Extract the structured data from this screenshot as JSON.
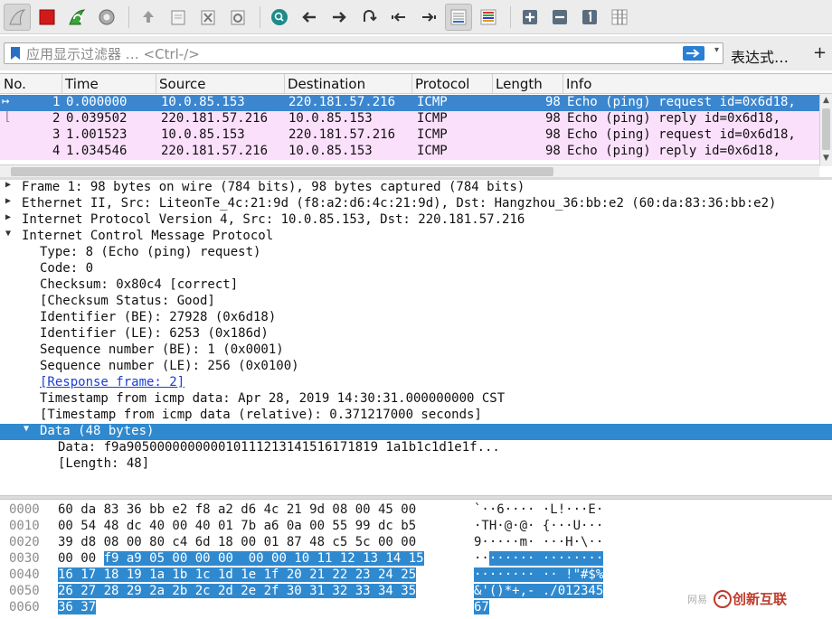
{
  "filter": {
    "placeholder": "应用显示过滤器 … <Ctrl-/>",
    "expression_label": "表达式…",
    "add_label": "+"
  },
  "toolbar": {
    "icons": [
      "shark-fin-start-icon",
      "stop-capture-icon",
      "restart-capture-icon",
      "capture-options-icon",
      "open-file-icon",
      "save-file-icon",
      "close-file-icon",
      "reload-file-icon",
      "find-packet-icon",
      "go-back-icon",
      "go-forward-icon",
      "go-to-packet-icon",
      "first-packet-icon",
      "last-packet-icon",
      "autoscroll-icon",
      "colorize-icon",
      "zoom-in-icon",
      "zoom-out-icon",
      "normal-size-icon",
      "resize-columns-icon"
    ]
  },
  "packet_list": {
    "columns": [
      "No.",
      "Time",
      "Source",
      "Destination",
      "Protocol",
      "Length",
      "Info"
    ],
    "rows": [
      {
        "no": "1",
        "time": "0.000000",
        "src": "10.0.85.153",
        "dst": "220.181.57.216",
        "proto": "ICMP",
        "len": "98",
        "info": "Echo (ping) request  id=0x6d18,"
      },
      {
        "no": "2",
        "time": "0.039502",
        "src": "220.181.57.216",
        "dst": "10.0.85.153",
        "proto": "ICMP",
        "len": "98",
        "info": "Echo (ping) reply    id=0x6d18,"
      },
      {
        "no": "3",
        "time": "1.001523",
        "src": "10.0.85.153",
        "dst": "220.181.57.216",
        "proto": "ICMP",
        "len": "98",
        "info": "Echo (ping) request  id=0x6d18,"
      },
      {
        "no": "4",
        "time": "1.034546",
        "src": "220.181.57.216",
        "dst": "10.0.85.153",
        "proto": "ICMP",
        "len": "98",
        "info": "Echo (ping) reply    id=0x6d18,"
      }
    ]
  },
  "details": [
    {
      "text": "Frame 1: 98 bytes on wire (784 bits), 98 bytes captured (784 bits)",
      "level": 0,
      "arrow": "▶"
    },
    {
      "text": "Ethernet II, Src: LiteonTe_4c:21:9d (f8:a2:d6:4c:21:9d), Dst: Hangzhou_36:bb:e2 (60:da:83:36:bb:e2)",
      "level": 0,
      "arrow": "▶"
    },
    {
      "text": "Internet Protocol Version 4, Src: 10.0.85.153, Dst: 220.181.57.216",
      "level": 0,
      "arrow": "▶"
    },
    {
      "text": "Internet Control Message Protocol",
      "level": 0,
      "arrow": "▼"
    },
    {
      "text": "Type: 8 (Echo (ping) request)",
      "level": 1,
      "arrow": ""
    },
    {
      "text": "Code: 0",
      "level": 1,
      "arrow": ""
    },
    {
      "text": "Checksum: 0x80c4 [correct]",
      "level": 1,
      "arrow": ""
    },
    {
      "text": "[Checksum Status: Good]",
      "level": 1,
      "arrow": ""
    },
    {
      "text": "Identifier (BE): 27928 (0x6d18)",
      "level": 1,
      "arrow": ""
    },
    {
      "text": "Identifier (LE): 6253 (0x186d)",
      "level": 1,
      "arrow": ""
    },
    {
      "text": "Sequence number (BE): 1 (0x0001)",
      "level": 1,
      "arrow": ""
    },
    {
      "text": "Sequence number (LE): 256 (0x0100)",
      "level": 1,
      "arrow": ""
    },
    {
      "text": "[Response frame: 2]",
      "level": 1,
      "arrow": "",
      "link": true
    },
    {
      "text": "Timestamp from icmp data: Apr 28, 2019 14:30:31.000000000 CST",
      "level": 1,
      "arrow": ""
    },
    {
      "text": "[Timestamp from icmp data (relative): 0.371217000 seconds]",
      "level": 1,
      "arrow": ""
    },
    {
      "text": "Data (48 bytes)",
      "level": 1,
      "arrow": "▼",
      "selected": true
    },
    {
      "text": "Data: f9a905000000000010111213141516171819 1a1b1c1d1e1f...",
      "level": 2,
      "arrow": ""
    },
    {
      "text": "[Length: 48]",
      "level": 2,
      "arrow": ""
    }
  ],
  "bytes": [
    {
      "offset": "0000",
      "hex_a": "60 da 83 36 bb e2 f8 a2  d6 4c 21 9d 08 00 45 00",
      "hex_hl": "",
      "ascii_a": "`··6···· ·L!···E·",
      "ascii_hl": ""
    },
    {
      "offset": "0010",
      "hex_a": "00 54 48 dc 40 00 40 01  7b a6 0a 00 55 99 dc b5",
      "hex_hl": "",
      "ascii_a": "·TH·@·@· {···U···",
      "ascii_hl": ""
    },
    {
      "offset": "0020",
      "hex_a": "39 d8 08 00 80 c4 6d 18  00 01 87 48 c5 5c 00 00",
      "hex_hl": "",
      "ascii_a": "9·····m· ···H·\\··",
      "ascii_hl": ""
    },
    {
      "offset": "0030",
      "hex_a": "00 00 ",
      "hex_hl": "f9 a9 05 00 00 00  00 00 10 11 12 13 14 15",
      "ascii_a": "··",
      "ascii_hl": "······ ········"
    },
    {
      "offset": "0040",
      "hex_a": "",
      "hex_hl": "16 17 18 19 1a 1b 1c 1d  1e 1f 20 21 22 23 24 25",
      "ascii_a": "",
      "ascii_hl": "········ ·· !\"#$%"
    },
    {
      "offset": "0050",
      "hex_a": "",
      "hex_hl": "26 27 28 29 2a 2b 2c 2d  2e 2f 30 31 32 33 34 35",
      "ascii_a": "",
      "ascii_hl": "&'()*+,- ./012345"
    },
    {
      "offset": "0060",
      "hex_a": "",
      "hex_hl": "36 37",
      "ascii_a": "",
      "ascii_hl": "67"
    }
  ],
  "watermark": {
    "small": "网易",
    "logo": "创新互联"
  },
  "colors": {
    "selected": "#3b86cf",
    "icmp_row": "#fbe0fb",
    "detail_selected": "#2f89cf"
  }
}
